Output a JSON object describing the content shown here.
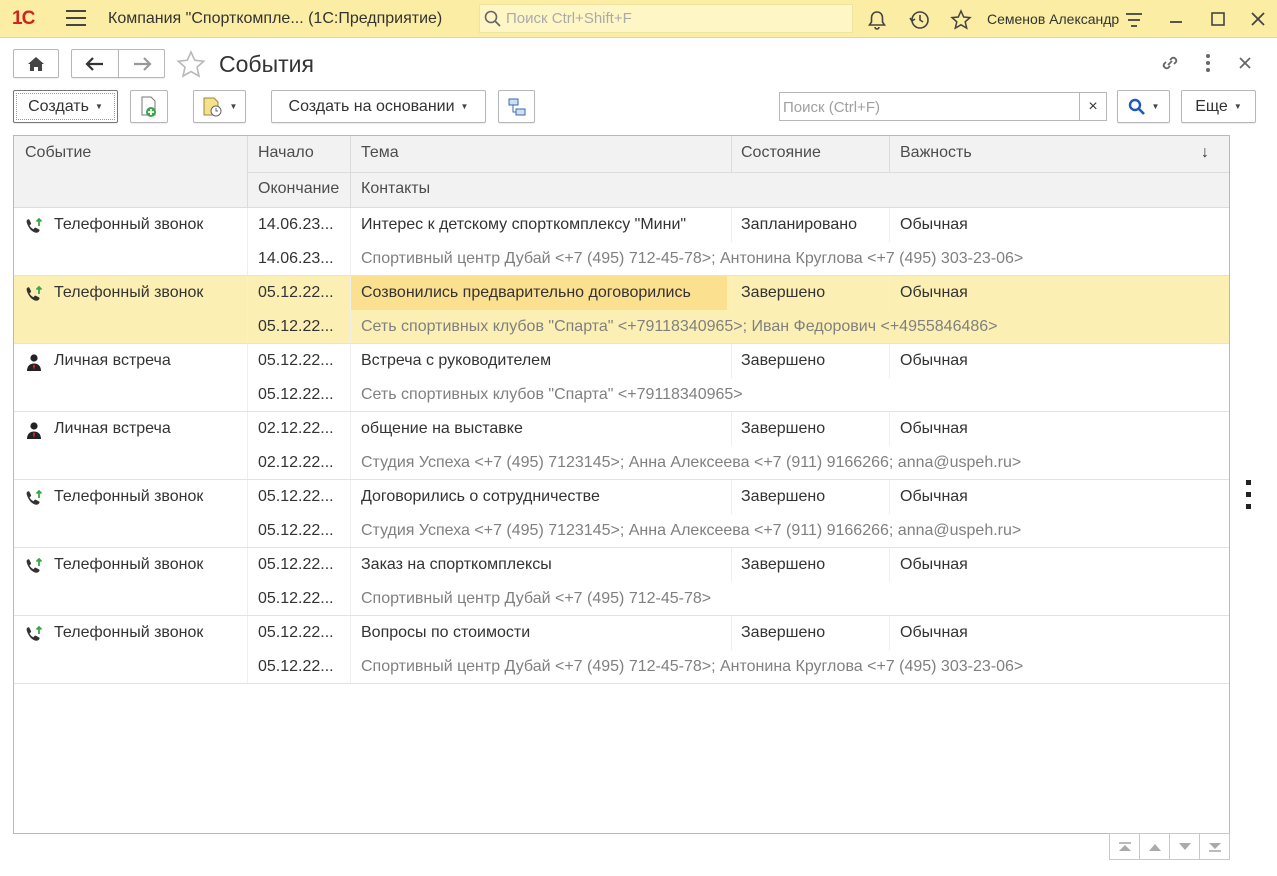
{
  "app": {
    "logo": "1С",
    "title": "Компания \"Спорткомпле...  (1С:Предприятие)",
    "search_placeholder": "Поиск Ctrl+Shift+F",
    "user": "Семенов Александр",
    "icons": [
      "menu-icon",
      "bell-icon",
      "history-icon",
      "star-icon",
      "settings-icon",
      "minimize-icon",
      "maximize-icon",
      "close-icon"
    ]
  },
  "form": {
    "title": "События",
    "toolbar": {
      "create_label": "Создать",
      "create_based_label": "Создать на основании",
      "search_placeholder": "Поиск (Ctrl+F)",
      "clear_label": "×",
      "more_label": "Еще"
    }
  },
  "table": {
    "headers": {
      "event": "Событие",
      "start": "Начало",
      "end": "Окончание",
      "subject": "Тема",
      "contacts": "Контакты",
      "state": "Состояние",
      "importance": "Важность",
      "sort_arrow": "↓"
    },
    "rows": [
      {
        "icon": "phone-call-icon",
        "event": "Телефонный звонок",
        "start": "14.06.23...",
        "end": "14.06.23...",
        "subject": "Интерес к детскому спорткомплексу \"Мини\"",
        "contacts": "Спортивный центр Дубай <+7 (495) 712-45-78>; Антонина Круглова <+7 (495) 303-23-06>",
        "state": "Запланировано",
        "importance": "Обычная"
      },
      {
        "icon": "phone-call-icon",
        "event": "Телефонный звонок",
        "start": "05.12.22...",
        "end": "05.12.22...",
        "subject": "Созвонились предварительно договорились",
        "contacts": "Сеть спортивных клубов \"Спарта\" <+79118340965>; Иван Федорович <+4955846486>",
        "state": "Завершено",
        "importance": "Обычная",
        "selected": true
      },
      {
        "icon": "person-meeting-icon",
        "event": "Личная встреча",
        "start": "05.12.22...",
        "end": "05.12.22...",
        "subject": "Встреча с руководителем",
        "contacts": "Сеть спортивных клубов \"Спарта\" <+79118340965>",
        "state": "Завершено",
        "importance": "Обычная"
      },
      {
        "icon": "person-meeting-icon",
        "event": "Личная встреча",
        "start": "02.12.22...",
        "end": "02.12.22...",
        "subject": "общение на выставке",
        "contacts": "Студия Успеха <+7 (495) 7123145>; Анна Алексеева <+7 (911) 9166266; anna@uspeh.ru>",
        "state": "Завершено",
        "importance": "Обычная"
      },
      {
        "icon": "phone-call-icon",
        "event": "Телефонный звонок",
        "start": "05.12.22...",
        "end": "05.12.22...",
        "subject": "Договорились о сотрудничестве",
        "contacts": "Студия Успеха <+7 (495) 7123145>; Анна Алексеева <+7 (911) 9166266; anna@uspeh.ru>",
        "state": "Завершено",
        "importance": "Обычная"
      },
      {
        "icon": "phone-call-icon",
        "event": "Телефонный звонок",
        "start": "05.12.22...",
        "end": "05.12.22...",
        "subject": "Заказ на спорткомплексы",
        "contacts": "Спортивный центр Дубай <+7 (495) 712-45-78>",
        "state": "Завершено",
        "importance": "Обычная"
      },
      {
        "icon": "phone-call-icon",
        "event": "Телефонный звонок",
        "start": "05.12.22...",
        "end": "05.12.22...",
        "subject": "Вопросы по стоимости",
        "contacts": "Спортивный центр Дубай <+7 (495) 712-45-78>; Антонина Круглова <+7 (495) 303-23-06>",
        "state": "Завершено",
        "importance": "Обычная"
      }
    ]
  },
  "colors": {
    "topbar": "#fbeda4",
    "selected_row": "#fcefb3",
    "selected_cell": "#fbe18f",
    "accent_red": "#d2231f",
    "accent_green": "#3aa64a"
  }
}
